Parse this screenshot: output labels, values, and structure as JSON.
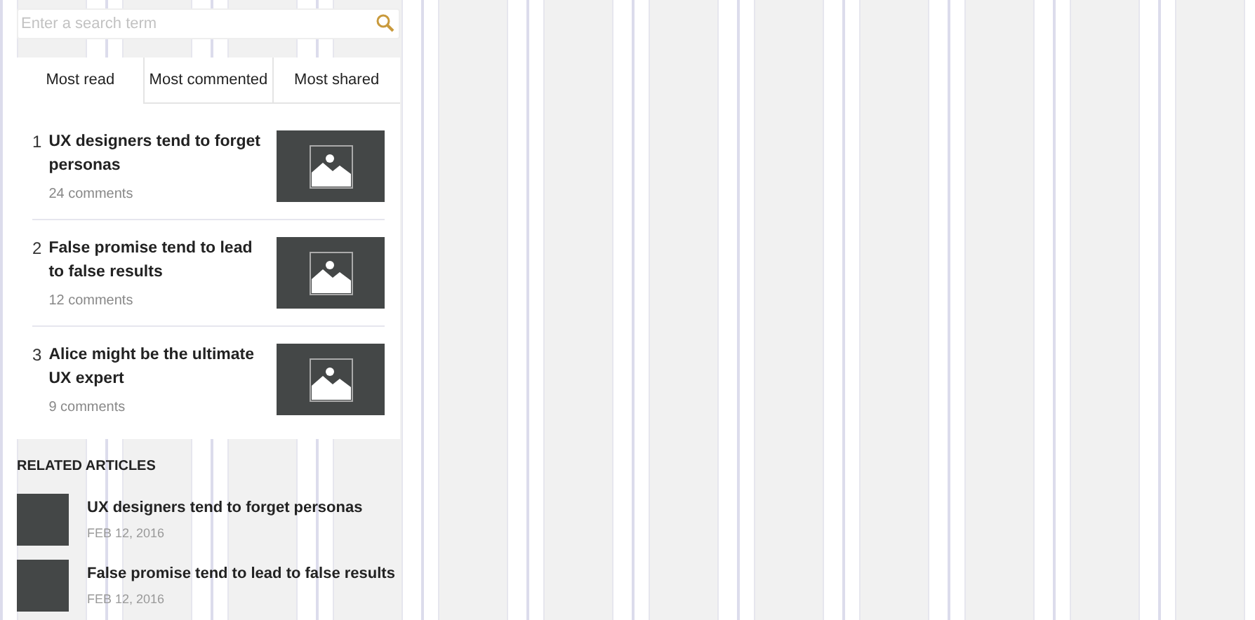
{
  "search": {
    "placeholder": "Enter a search term"
  },
  "tabs": [
    {
      "label": "Most read",
      "selected": true
    },
    {
      "label": "Most commented",
      "selected": false
    },
    {
      "label": "Most shared",
      "selected": false
    }
  ],
  "articles": [
    {
      "rank": "1",
      "title": "UX designers tend to forget personas",
      "comments": "24 comments"
    },
    {
      "rank": "2",
      "title": "False promise tend to lead to false results",
      "comments": "12 comments"
    },
    {
      "rank": "3",
      "title": "Alice might be the ultimate UX expert",
      "comments": "9 comments"
    }
  ],
  "related": {
    "heading": "RELATED ARTICLES",
    "items": [
      {
        "title": "UX designers tend to forget personas",
        "date": "FEB 12, 2016"
      },
      {
        "title": "False promise tend to lead to false results",
        "date": "FEB 12, 2016"
      }
    ]
  }
}
